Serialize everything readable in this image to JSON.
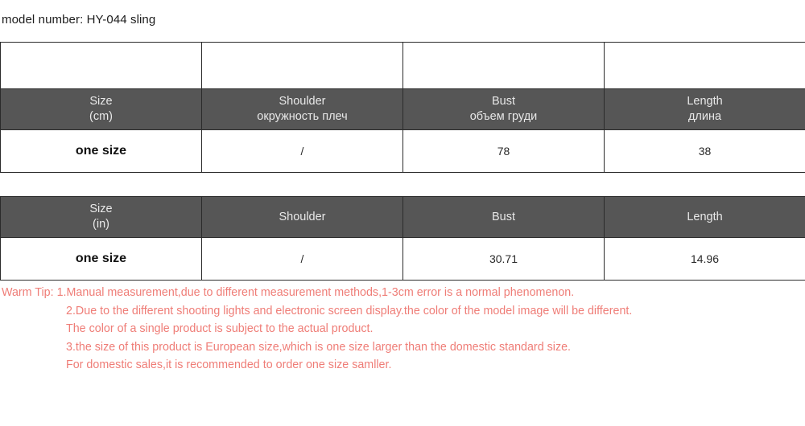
{
  "header": {
    "model_label": "model number: HY-044 sling"
  },
  "colors": {
    "header_bg": "#565656",
    "header_text": "#e8e8e8",
    "border": "#2b2b2b",
    "tip_text": "#ef7d77",
    "page_bg": "#ffffff"
  },
  "tables": [
    {
      "id": "cm",
      "has_blank_row": true,
      "headers": [
        {
          "main": "Size",
          "sub": "(cm)"
        },
        {
          "main": "Shoulder",
          "sub": "окружность плеч"
        },
        {
          "main": "Bust",
          "sub": "объем груди"
        },
        {
          "main": "Length",
          "sub": "длина"
        }
      ],
      "rows": [
        {
          "cells": [
            "one size",
            "/",
            "78",
            "38"
          ]
        }
      ]
    },
    {
      "id": "in",
      "has_blank_row": false,
      "headers": [
        {
          "main": "Size",
          "sub": "(in)"
        },
        {
          "main": "Shoulder",
          "sub": ""
        },
        {
          "main": "Bust",
          "sub": ""
        },
        {
          "main": "Length",
          "sub": ""
        }
      ],
      "rows": [
        {
          "cells": [
            "one size",
            "/",
            "30.71",
            "14.96"
          ]
        }
      ]
    }
  ],
  "warm_tip": {
    "label": "Warm Tip:",
    "lines": [
      "1.Manual measurement,due to different measurement methods,1-3cm error is a normal phenomenon.",
      "2.Due to the different shooting lights and electronic screen display.the color of the model image will be different.",
      "The color of a single product is subject to the actual product.",
      "3.the size of this product is European size,which is one size larger than the domestic standard size.",
      "For domestic sales,it is recommended to order one size samller."
    ]
  }
}
